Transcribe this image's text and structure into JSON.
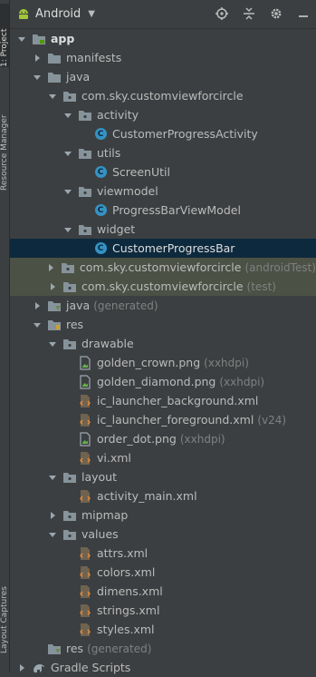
{
  "toolbar": {
    "view_label": "Android",
    "icons": [
      "android-icon",
      "chevron-down-icon",
      "locate-icon",
      "collapse-icon",
      "gear-icon",
      "hide-icon"
    ]
  },
  "side_tabs": {
    "project": "1: Project",
    "resource_manager": "Resource Manager",
    "layout_captures": "Layout Captures"
  },
  "tree": [
    {
      "label": "app",
      "hint": "",
      "depth": 0,
      "arrow": "down",
      "icon": "module",
      "bold": true
    },
    {
      "label": "manifests",
      "hint": "",
      "depth": 1,
      "arrow": "right",
      "icon": "folder"
    },
    {
      "label": "java",
      "hint": "",
      "depth": 1,
      "arrow": "down",
      "icon": "folder"
    },
    {
      "label": "com.sky.customviewforcircle",
      "hint": "",
      "depth": 2,
      "arrow": "down",
      "icon": "package"
    },
    {
      "label": "activity",
      "hint": "",
      "depth": 3,
      "arrow": "down",
      "icon": "package"
    },
    {
      "label": "CustomerProgressActivity",
      "hint": "",
      "depth": 4,
      "arrow": "",
      "icon": "class"
    },
    {
      "label": "utils",
      "hint": "",
      "depth": 3,
      "arrow": "down",
      "icon": "package"
    },
    {
      "label": "ScreenUtil",
      "hint": "",
      "depth": 4,
      "arrow": "",
      "icon": "class"
    },
    {
      "label": "viewmodel",
      "hint": "",
      "depth": 3,
      "arrow": "down",
      "icon": "package"
    },
    {
      "label": "ProgressBarViewModel",
      "hint": "",
      "depth": 4,
      "arrow": "",
      "icon": "class"
    },
    {
      "label": "widget",
      "hint": "",
      "depth": 3,
      "arrow": "down",
      "icon": "package"
    },
    {
      "label": "CustomerProgressBar",
      "hint": "",
      "depth": 4,
      "arrow": "",
      "icon": "class",
      "selected": true
    },
    {
      "label": "com.sky.customviewforcircle",
      "hint": "(androidTest)",
      "depth": 2,
      "arrow": "right",
      "icon": "package",
      "scope": true
    },
    {
      "label": "com.sky.customviewforcircle",
      "hint": "(test)",
      "depth": 2,
      "arrow": "right",
      "icon": "package",
      "scope": true
    },
    {
      "label": "java",
      "hint": "(generated)",
      "depth": 1,
      "arrow": "right",
      "icon": "folder-gen"
    },
    {
      "label": "res",
      "hint": "",
      "depth": 1,
      "arrow": "down",
      "icon": "folder-res"
    },
    {
      "label": "drawable",
      "hint": "",
      "depth": 2,
      "arrow": "down",
      "icon": "package"
    },
    {
      "label": "golden_crown.png",
      "hint": "(xxhdpi)",
      "depth": 3,
      "arrow": "",
      "icon": "image"
    },
    {
      "label": "golden_diamond.png",
      "hint": "(xxhdpi)",
      "depth": 3,
      "arrow": "",
      "icon": "image"
    },
    {
      "label": "ic_launcher_background.xml",
      "hint": "",
      "depth": 3,
      "arrow": "",
      "icon": "xml"
    },
    {
      "label": "ic_launcher_foreground.xml",
      "hint": "(v24)",
      "depth": 3,
      "arrow": "",
      "icon": "xml"
    },
    {
      "label": "order_dot.png",
      "hint": "(xxhdpi)",
      "depth": 3,
      "arrow": "",
      "icon": "image"
    },
    {
      "label": "vi.xml",
      "hint": "",
      "depth": 3,
      "arrow": "",
      "icon": "xml"
    },
    {
      "label": "layout",
      "hint": "",
      "depth": 2,
      "arrow": "down",
      "icon": "package"
    },
    {
      "label": "activity_main.xml",
      "hint": "",
      "depth": 3,
      "arrow": "",
      "icon": "xml"
    },
    {
      "label": "mipmap",
      "hint": "",
      "depth": 2,
      "arrow": "right",
      "icon": "package"
    },
    {
      "label": "values",
      "hint": "",
      "depth": 2,
      "arrow": "down",
      "icon": "package"
    },
    {
      "label": "attrs.xml",
      "hint": "",
      "depth": 3,
      "arrow": "",
      "icon": "xml"
    },
    {
      "label": "colors.xml",
      "hint": "",
      "depth": 3,
      "arrow": "",
      "icon": "xml"
    },
    {
      "label": "dimens.xml",
      "hint": "",
      "depth": 3,
      "arrow": "",
      "icon": "xml"
    },
    {
      "label": "strings.xml",
      "hint": "",
      "depth": 3,
      "arrow": "",
      "icon": "xml"
    },
    {
      "label": "styles.xml",
      "hint": "",
      "depth": 3,
      "arrow": "",
      "icon": "xml"
    },
    {
      "label": "res",
      "hint": "(generated)",
      "depth": 1,
      "arrow": "",
      "icon": "folder-gen"
    },
    {
      "label": "Gradle Scripts",
      "hint": "",
      "depth": 0,
      "arrow": "right",
      "icon": "gradle"
    }
  ],
  "colors": {
    "background": "#3c3f41",
    "selected_row": "#0d293e",
    "scope_row": "#4b5144",
    "class_icon": "#3592c4",
    "hint_text": "#808080"
  }
}
